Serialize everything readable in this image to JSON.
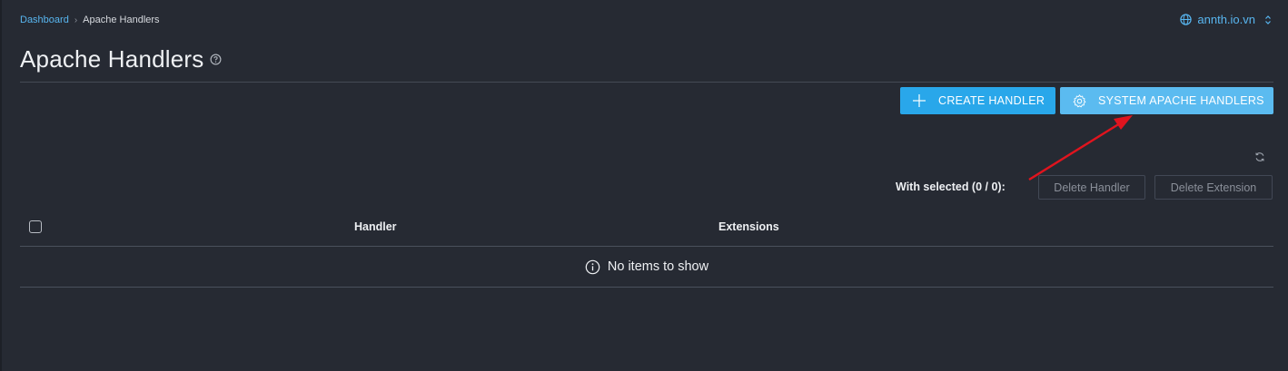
{
  "breadcrumb": {
    "root": "Dashboard",
    "separator": "›",
    "current": "Apache Handlers"
  },
  "domain_switch": {
    "label": "annth.io.vn",
    "icon": "globe-icon"
  },
  "page": {
    "title": "Apache Handlers",
    "help_icon": "help-circle-icon"
  },
  "actions": {
    "create_label": "CREATE HANDLER",
    "create_icon": "plus-icon",
    "system_label": "SYSTEM APACHE HANDLERS",
    "system_icon": "gear-icon"
  },
  "selection": {
    "label": "With selected (0 / 0):",
    "delete_handler": "Delete Handler",
    "delete_extension": "Delete Extension"
  },
  "table": {
    "columns": [
      "Handler",
      "Extensions"
    ],
    "empty_message": "No items to show"
  },
  "colors": {
    "background": "#262a33",
    "accent": "#29a7ea",
    "accent_light": "#5bbbf0",
    "link": "#58b6f0",
    "annotation_arrow": "#e0141e"
  }
}
